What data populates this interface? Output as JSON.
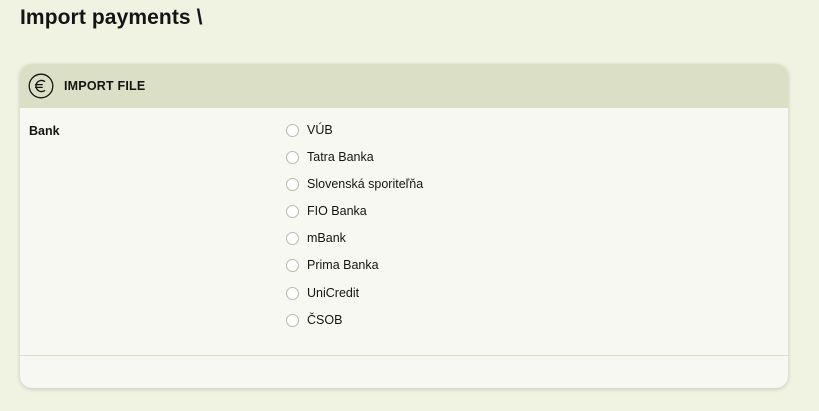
{
  "page": {
    "title": "Import payments \\"
  },
  "card": {
    "title": "IMPORT FILE",
    "header_icon": "euro-circle-icon"
  },
  "form": {
    "bank_label": "Bank",
    "bank_options": [
      {
        "label": "VÚB",
        "selected": false
      },
      {
        "label": "Tatra Banka",
        "selected": false
      },
      {
        "label": "Slovenská sporiteľňa",
        "selected": false
      },
      {
        "label": "FIO Banka",
        "selected": false
      },
      {
        "label": "mBank",
        "selected": false
      },
      {
        "label": "Prima Banka",
        "selected": false
      },
      {
        "label": "UniCredit",
        "selected": false
      },
      {
        "label": "ČSOB",
        "selected": false
      }
    ]
  },
  "colors": {
    "background": "#f0f2e2",
    "card": "#f8f8f2",
    "header": "#dbdfc5",
    "text": "#141414",
    "radio_border": "#b9baae"
  }
}
